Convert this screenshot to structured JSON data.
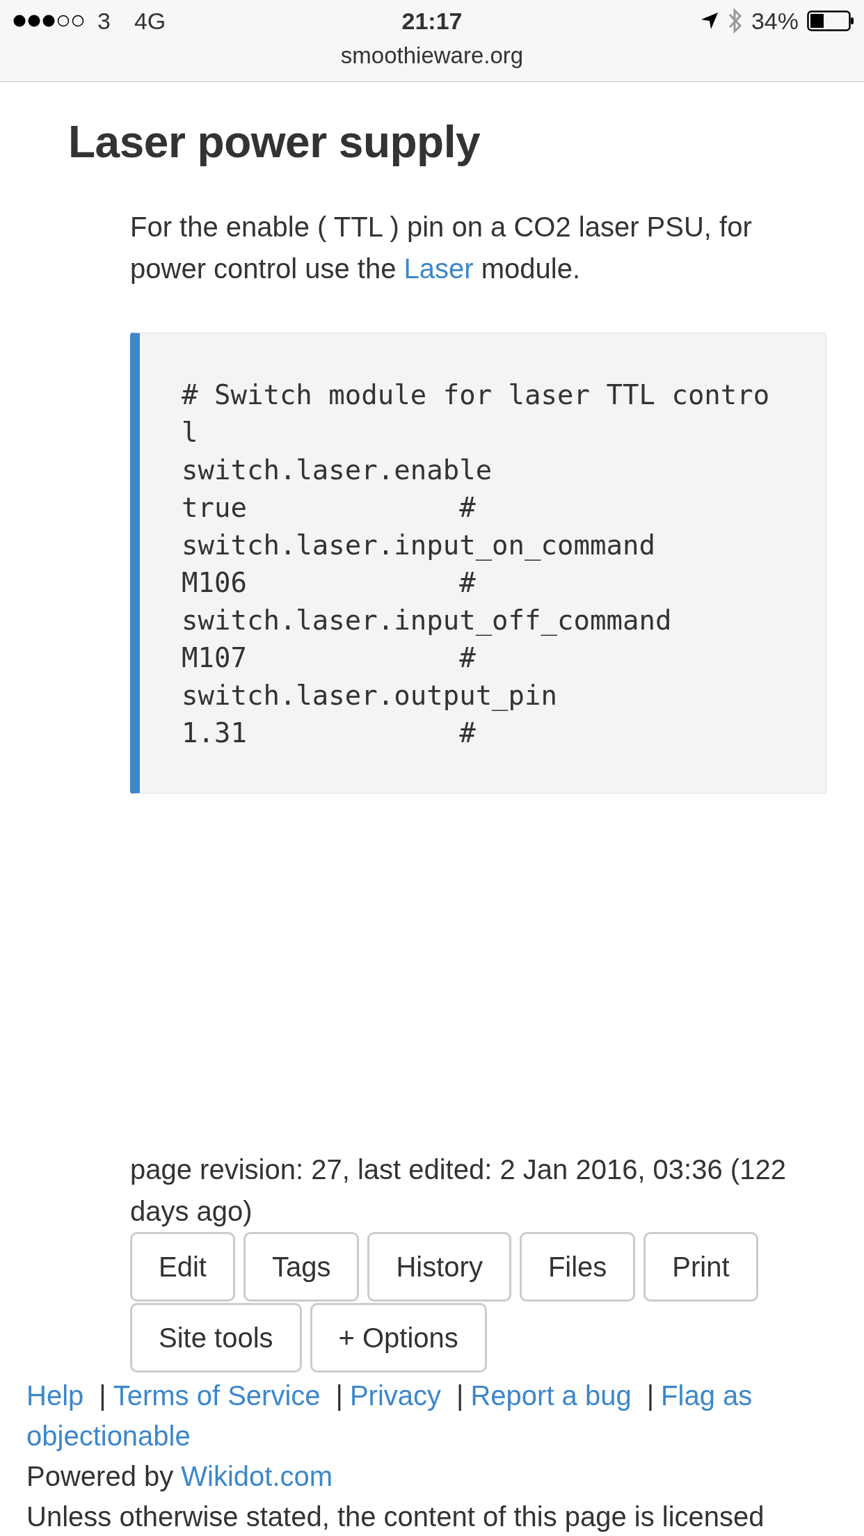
{
  "status_bar": {
    "carrier": "3",
    "network": "4G",
    "time": "21:17",
    "battery": "34%",
    "url": "smoothieware.org"
  },
  "title": "Laser power supply",
  "intro": {
    "before": "For the enable ( TTL ) pin on a CO2 laser PSU, for power control use the ",
    "link": "Laser",
    "after": " module."
  },
  "code_lines": [
    "# Switch module for laser TTL control",
    "switch.laser.enable",
    "true             #",
    "switch.laser.input_on_command",
    "M106             #",
    "switch.laser.input_off_command",
    "M107             #",
    "switch.laser.output_pin",
    "1.31             #"
  ],
  "revision": "page revision: 27, last edited: 2 Jan 2016, 03:36 (122 days ago)",
  "buttons": [
    [
      "Edit",
      "Tags",
      "History",
      "Files",
      "Print"
    ],
    [
      "Site tools",
      "+ Options"
    ]
  ],
  "footer_links": [
    {
      "kind": "link",
      "text": "Help"
    },
    {
      "kind": "separator",
      "text": "|"
    },
    {
      "kind": "link",
      "text": "Terms of Service"
    },
    {
      "kind": "separator",
      "text": "|"
    },
    {
      "kind": "link",
      "text": "Privacy"
    },
    {
      "kind": "separator",
      "text": "|"
    },
    {
      "kind": "link",
      "text": "Report a bug"
    },
    {
      "kind": "separator",
      "text": "|"
    },
    {
      "kind": "link",
      "lines": [
        "Flag as",
        "objectionable"
      ]
    }
  ],
  "powered_by": {
    "text": "Powered by ",
    "link": "Wikidot.com"
  },
  "license": "Unless otherwise stated, the content of this page is licensed"
}
